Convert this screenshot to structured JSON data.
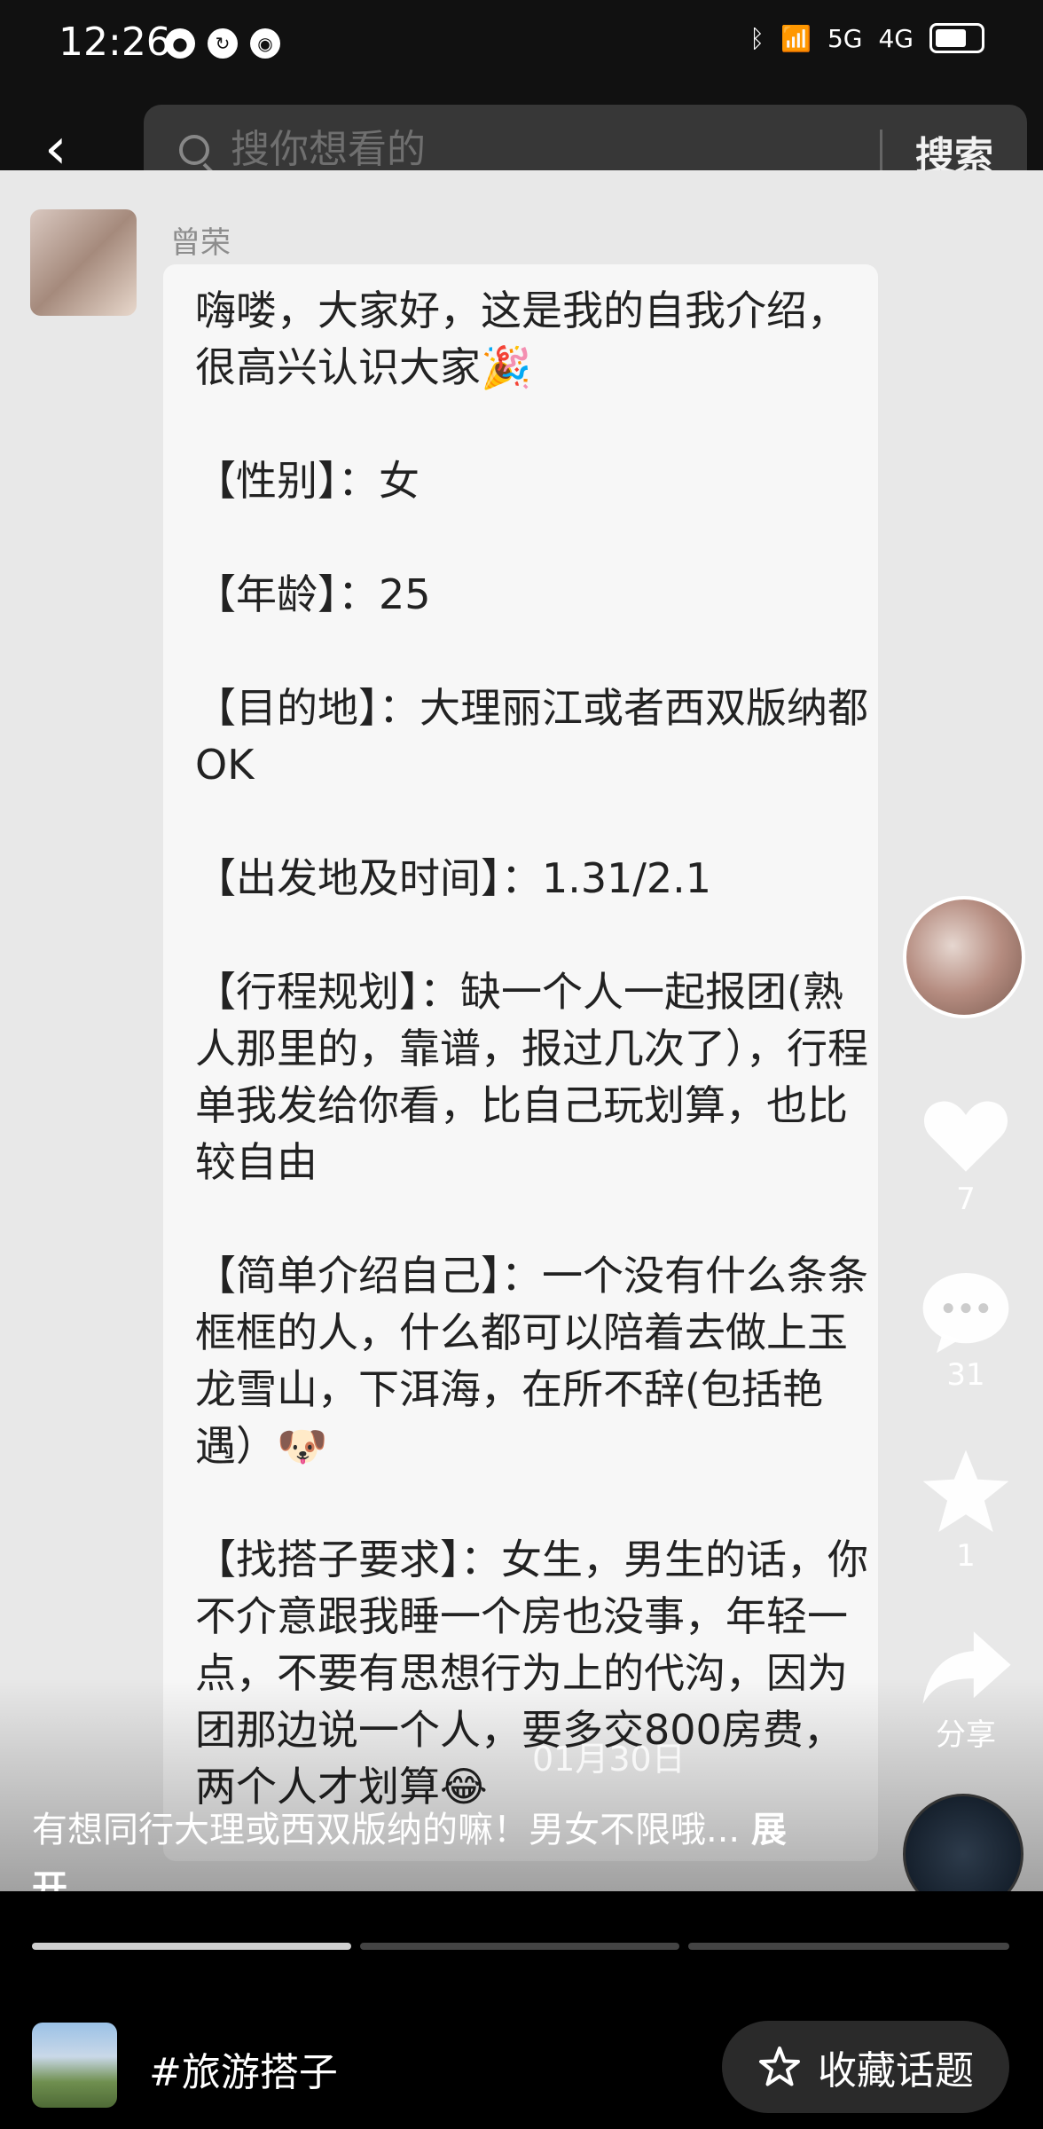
{
  "status": {
    "time": "12:26",
    "network_a": "5G",
    "network_b": "4G"
  },
  "search": {
    "placeholder": "搜你想看的",
    "button": "搜索"
  },
  "post": {
    "author": "曾荣",
    "content": "嗨喽，大家好，这是我的自我介绍，很高兴认识大家🎉\n\n【性别】：女\n\n【年龄】：25\n\n【目的地】：大理丽江或者西双版纳都OK\n\n【出发地及时间】：1.31/2.1\n\n【行程规划】：缺一个人一起报团(熟人那里的，靠谱，报过几次了），行程单我发给你看，比自己玩划算，也比较自由\n\n【简单介绍自己】：一个没有什么条条框框的人，什么都可以陪着去做上玉龙雪山，下洱海，在所不辞(包括艳遇）🐶\n\n【找搭子要求】：女生，男生的话，你不介意跟我睡一个房也没事，年轻一点，不要有思想行为上的代沟，因为团那边说一个人，要多交800房费，两个人才划算😂",
    "date": "01月30日",
    "caption": "有想同行大理或西双版纳的嘛！男女不限哦...",
    "expand": "展开"
  },
  "actions": {
    "like_count": "7",
    "comment_count": "31",
    "favorite_count": "1",
    "share_label": "分享"
  },
  "topic": {
    "label": "#旅游搭子",
    "collect_label": "收藏话题"
  },
  "progress": {
    "segments": 3,
    "active_segment": 1
  },
  "colors": {
    "background": "#000000",
    "content_bg": "#e8e8e8",
    "bubble_bg": "#f7f7f7",
    "text": "#222222"
  }
}
